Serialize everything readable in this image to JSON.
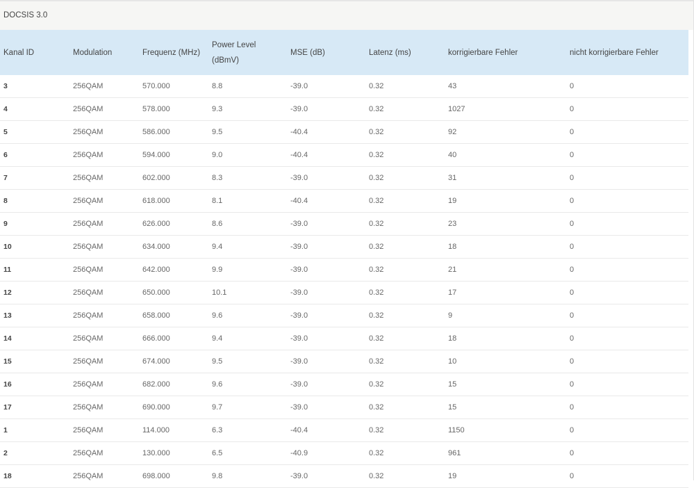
{
  "panel": {
    "title": "DOCSIS 3.0"
  },
  "table": {
    "columns": [
      "Kanal ID",
      "Modulation",
      "Frequenz (MHz)",
      "Power Level (dBmV)",
      "MSE (dB)",
      "Latenz (ms)",
      "korrigierbare Fehler",
      "nicht korrigierbare Fehler"
    ],
    "rows": [
      [
        "3",
        "256QAM",
        "570.000",
        "8.8",
        "-39.0",
        "0.32",
        "43",
        "0"
      ],
      [
        "4",
        "256QAM",
        "578.000",
        "9.3",
        "-39.0",
        "0.32",
        "1027",
        "0"
      ],
      [
        "5",
        "256QAM",
        "586.000",
        "9.5",
        "-40.4",
        "0.32",
        "92",
        "0"
      ],
      [
        "6",
        "256QAM",
        "594.000",
        "9.0",
        "-40.4",
        "0.32",
        "40",
        "0"
      ],
      [
        "7",
        "256QAM",
        "602.000",
        "8.3",
        "-39.0",
        "0.32",
        "31",
        "0"
      ],
      [
        "8",
        "256QAM",
        "618.000",
        "8.1",
        "-40.4",
        "0.32",
        "19",
        "0"
      ],
      [
        "9",
        "256QAM",
        "626.000",
        "8.6",
        "-39.0",
        "0.32",
        "23",
        "0"
      ],
      [
        "10",
        "256QAM",
        "634.000",
        "9.4",
        "-39.0",
        "0.32",
        "18",
        "0"
      ],
      [
        "11",
        "256QAM",
        "642.000",
        "9.9",
        "-39.0",
        "0.32",
        "21",
        "0"
      ],
      [
        "12",
        "256QAM",
        "650.000",
        "10.1",
        "-39.0",
        "0.32",
        "17",
        "0"
      ],
      [
        "13",
        "256QAM",
        "658.000",
        "9.6",
        "-39.0",
        "0.32",
        "9",
        "0"
      ],
      [
        "14",
        "256QAM",
        "666.000",
        "9.4",
        "-39.0",
        "0.32",
        "18",
        "0"
      ],
      [
        "15",
        "256QAM",
        "674.000",
        "9.5",
        "-39.0",
        "0.32",
        "10",
        "0"
      ],
      [
        "16",
        "256QAM",
        "682.000",
        "9.6",
        "-39.0",
        "0.32",
        "15",
        "0"
      ],
      [
        "17",
        "256QAM",
        "690.000",
        "9.7",
        "-39.0",
        "0.32",
        "15",
        "0"
      ],
      [
        "1",
        "256QAM",
        "114.000",
        "6.3",
        "-40.4",
        "0.32",
        "1150",
        "0"
      ],
      [
        "2",
        "256QAM",
        "130.000",
        "6.5",
        "-40.9",
        "0.32",
        "961",
        "0"
      ],
      [
        "18",
        "256QAM",
        "698.000",
        "9.8",
        "-39.0",
        "0.32",
        "19",
        "0"
      ]
    ]
  }
}
